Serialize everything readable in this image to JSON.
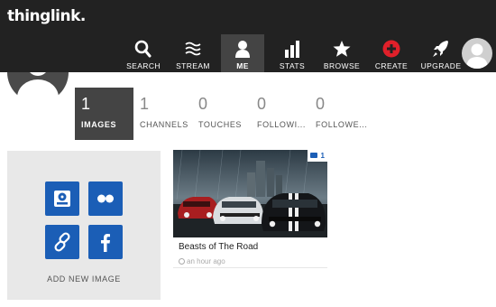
{
  "brand": {
    "logo_text": "thinglink."
  },
  "nav": [
    {
      "label": "SEARCH",
      "icon": "search-icon"
    },
    {
      "label": "STREAM",
      "icon": "stream-icon"
    },
    {
      "label": "ME",
      "icon": "user-icon",
      "active": true
    },
    {
      "label": "STATS",
      "icon": "bar-chart-icon"
    },
    {
      "label": "BROWSE",
      "icon": "star-icon"
    },
    {
      "label": "CREATE",
      "icon": "plus-circle-icon"
    },
    {
      "label": "UPGRADE",
      "icon": "rocket-icon"
    }
  ],
  "profile_stats": [
    {
      "value": "1",
      "label": "IMAGES",
      "active": true
    },
    {
      "value": "1",
      "label": "CHANNELS"
    },
    {
      "value": "0",
      "label": "TOUCHES"
    },
    {
      "value": "0",
      "label": "FOLLOWI..."
    },
    {
      "value": "0",
      "label": "FOLLOWE..."
    }
  ],
  "add_panel": {
    "label": "ADD NEW IMAGE",
    "sources": [
      "hard-drive-icon",
      "flickr-icon",
      "link-icon",
      "facebook-icon"
    ]
  },
  "image_card": {
    "title": "Beasts of The Road",
    "time": "an hour ago",
    "comment_count": "1"
  },
  "colors": {
    "topbar": "#222222",
    "active_tab": "#444444",
    "accent_blue": "#1b5eb6",
    "create_red": "#e0202a"
  }
}
